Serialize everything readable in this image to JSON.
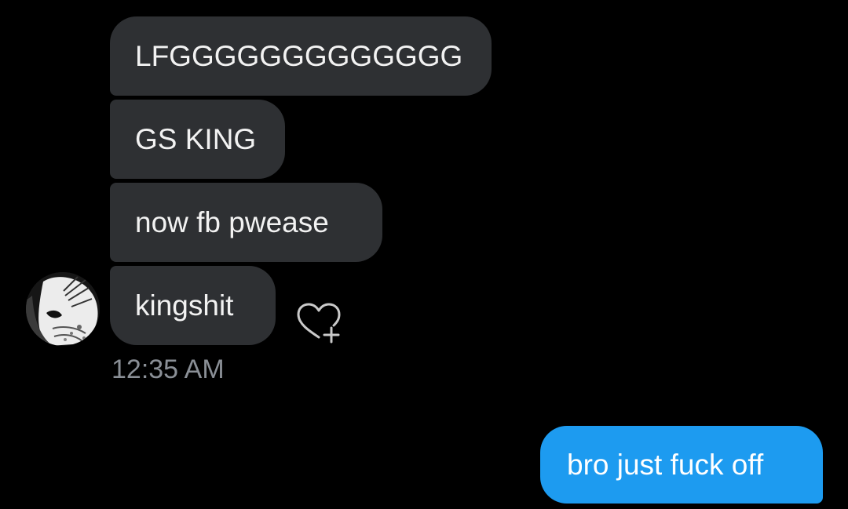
{
  "conversation": {
    "incoming_messages": [
      {
        "text": "LFGGGGGGGGGGGGG"
      },
      {
        "text": "GS KING"
      },
      {
        "text": "now fb pwease"
      },
      {
        "text": "kingshit"
      }
    ],
    "timestamp": "12:35 AM",
    "outgoing_messages": [
      {
        "text": "bro just fuck off"
      }
    ]
  },
  "reaction_button": {
    "icon": "heart-plus-icon"
  },
  "avatar": {
    "icon": "profile-avatar"
  },
  "colors": {
    "background": "#000000",
    "incoming_bubble": "#2e3033",
    "outgoing_bubble": "#1d9bf0",
    "message_text": "#f2f2f2",
    "timestamp_text": "#8a8f96"
  }
}
